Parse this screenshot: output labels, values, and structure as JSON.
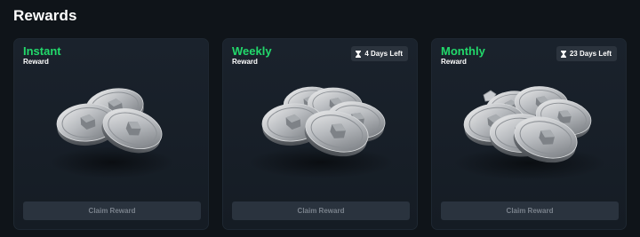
{
  "page": {
    "title": "Rewards"
  },
  "colors": {
    "accent": "#22d96b",
    "card_bg": "#1a222c",
    "button_bg": "#2a333e",
    "badge_bg": "#2b333d"
  },
  "cards": [
    {
      "title": "Instant",
      "subtitle": "Reward",
      "badge": "",
      "button": "Claim Reward",
      "icon": "silver-coin-pile-small-icon"
    },
    {
      "title": "Weekly",
      "subtitle": "Reward",
      "badge": "4 Days Left",
      "button": "Claim Reward",
      "icon": "silver-coin-pile-medium-icon"
    },
    {
      "title": "Monthly",
      "subtitle": "Reward",
      "badge": "23 Days Left",
      "button": "Claim Reward",
      "icon": "silver-coin-pile-large-icon"
    }
  ]
}
